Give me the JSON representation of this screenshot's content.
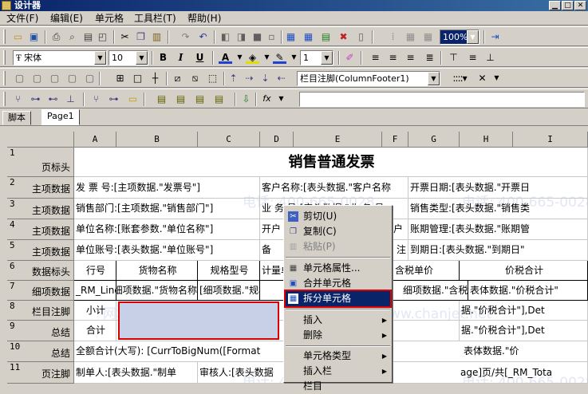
{
  "window": {
    "title": "设计器"
  },
  "menu": [
    "文件(F)",
    "编辑(E)",
    "单元格",
    "工具栏(T)",
    "帮助(H)"
  ],
  "toolbar": {
    "font_name": "宋体",
    "font_size": "10",
    "line_width": "1",
    "zoom": "100%",
    "footer_combo": "栏目注脚(ColumnFooter1)"
  },
  "formula": {
    "fx_label": "fx",
    "value": ""
  },
  "tabs": [
    "脚本",
    "Page1"
  ],
  "grid": {
    "columns": [
      "A",
      "B",
      "C",
      "D",
      "E",
      "F",
      "G",
      "H",
      "I"
    ],
    "rows": [
      {
        "num": "1",
        "label": "页标头"
      },
      {
        "num": "2",
        "label": "主项数据"
      },
      {
        "num": "3",
        "label": "主项数据"
      },
      {
        "num": "4",
        "label": "主项数据"
      },
      {
        "num": "5",
        "label": "主项数据"
      },
      {
        "num": "6",
        "label": "数据标头"
      },
      {
        "num": "7",
        "label": "细项数据"
      },
      {
        "num": "8",
        "label": "栏目注脚"
      },
      {
        "num": "9",
        "label": "总结"
      },
      {
        "num": "10",
        "label": "总结"
      },
      {
        "num": "11",
        "label": "页注脚"
      }
    ],
    "title": "销售普通发票",
    "r2": {
      "a": "发 票 号:[主项数据.\"发票号\"]",
      "d": "客户名称:[表头数据.\"客户名称",
      "g": "开票日期:[表头数据.\"开票日"
    },
    "r3": {
      "a": "销售部门:[主项数据.\"销售部门\"]",
      "d": "业 务 员:[表头数据.\"业 务 员",
      "g": "销售类型:[表头数据.\"销售类"
    },
    "r4": {
      "a": "单位名称:[账套参数.\"单位名称\"]",
      "d": "开户",
      "e": "开户",
      "g": "账期管理:[表头数据.\"账期管"
    },
    "r5": {
      "a": "单位账号:[表头数据.\"单位账号\"]",
      "d": "备",
      "f": "注",
      "g": "到期日:[表头数据.\"到期日\""
    },
    "r6": {
      "a": "行号",
      "b": "货物名称",
      "c": "规格型号",
      "d": "计量单",
      "f": "含税单价",
      "h": "价税合计"
    },
    "r7": {
      "a": "_RM_Line",
      "b": "[细项数据.\"货物名称",
      "c": "[细项数据.\"规格型",
      "f": "细项数据.\"含税单价",
      "h": "表体数据.\"价税合计\""
    },
    "r8": {
      "a": "小计",
      "h": "据.\"价税合计\"],Det"
    },
    "r9": {
      "a": "合计",
      "h": "据.\"价税合计\"],Det"
    },
    "r10": {
      "a": "全额合计(大写): [CurrToBigNum([Format",
      "h": "表体数据.\"价"
    },
    "r11": {
      "a": "制单人:[表头数据.\"制单",
      "c": "审核人:[表头数据",
      "h": "age]页/共[_RM_Tota"
    }
  },
  "watermark": {
    "phone": "电话: 400-665-0028",
    "site": "网址: www.chanjet.net"
  },
  "context_menu": {
    "items": [
      "剪切(U)",
      "复制(C)",
      "粘贴(P)",
      "单元格属性...",
      "合并单元格",
      "拆分单元格",
      "插入",
      "删除",
      "单元格类型",
      "插入栏",
      "栏目"
    ],
    "disabled": [
      2
    ],
    "submenu": [
      6,
      7,
      8,
      9
    ],
    "selected": 5
  },
  "colors": {
    "highlight_border": "#d80000",
    "selection_fill": "#c8d0e8",
    "menu_selected": "#0a246a",
    "title_bar": "#0a246a"
  }
}
